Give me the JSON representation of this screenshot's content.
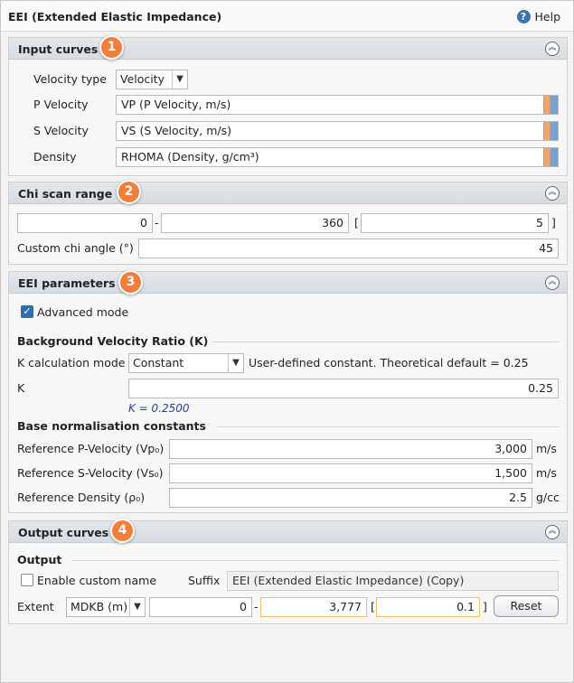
{
  "window": {
    "title": "EEI (Extended Elastic Impedance)",
    "help_label": "Help"
  },
  "input_curves": {
    "title": "Input curves",
    "badge": "1",
    "velocity_type_label": "Velocity type",
    "velocity_type_value": "Velocity",
    "p_velocity_label": "P Velocity",
    "p_velocity_value": "VP (P Velocity, m/s)",
    "s_velocity_label": "S Velocity",
    "s_velocity_value": "VS (S Velocity, m/s)",
    "density_label": "Density",
    "density_value": "RHOMA (Density, g/cm³)"
  },
  "chi_scan": {
    "title": "Chi scan range",
    "badge": "2",
    "from": "0",
    "dash": "-",
    "to": "360",
    "open_bracket": "[",
    "step": "5",
    "close_bracket": "]",
    "custom_label": "Custom chi angle (°)",
    "custom_value": "45"
  },
  "eei_params": {
    "title": "EEI parameters",
    "badge": "3",
    "advanced_label": "Advanced mode",
    "bvr_heading": "Background Velocity Ratio (K)",
    "k_mode_label": "K calculation mode",
    "k_mode_value": "Constant",
    "k_mode_note": "User-defined constant. Theoretical default = 0.25",
    "k_label": "K",
    "k_value": "0.25",
    "k_hint": "K = 0.2500",
    "base_heading": "Base normalisation constants",
    "vp0_label": "Reference P-Velocity (Vp₀)",
    "vp0_value": "3,000",
    "vp0_unit": "m/s",
    "vs0_label": "Reference S-Velocity (Vs₀)",
    "vs0_value": "1,500",
    "vs0_unit": "m/s",
    "rho0_label": "Reference Density (ρ₀)",
    "rho0_value": "2.5",
    "rho0_unit": "g/cc"
  },
  "output_curves": {
    "title": "Output curves",
    "badge": "4",
    "output_heading": "Output",
    "custom_name_label": "Enable custom name",
    "suffix_label": "Suffix",
    "suffix_value": "EEI (Extended Elastic Impedance) (Copy)",
    "extent_label": "Extent",
    "extent_value": "MDKB (m)",
    "from": "0",
    "dash": "-",
    "to": "3,777",
    "open_bracket": "[",
    "step": "0.1",
    "close_bracket": "]",
    "reset_label": "Reset"
  },
  "icons": {
    "collapse": "chevron-up-circle-icon",
    "curve_picker": "curve-picker-icon",
    "help": "help-icon"
  },
  "colors": {
    "badge": "#f07f3c",
    "accent": "#2f6fa8",
    "hint": "#2a3f9c"
  }
}
